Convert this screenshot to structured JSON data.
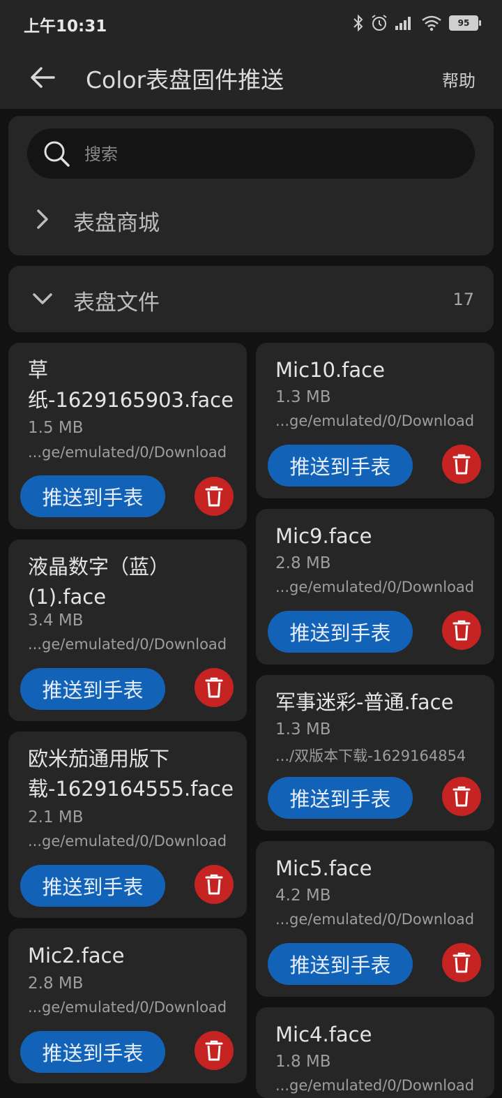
{
  "status_bar": {
    "time": "上午10:31",
    "battery": "95",
    "icons": [
      "bluetooth-icon",
      "alarm-icon",
      "signal-icon",
      "wifi-icon",
      "battery-icon"
    ]
  },
  "app_bar": {
    "title": "Color表盘固件推送",
    "help": "帮助",
    "back_icon": "arrow-back-icon"
  },
  "search": {
    "placeholder": "搜索"
  },
  "store": {
    "label": "表盘商城",
    "expanded": false
  },
  "files": {
    "label": "表盘文件",
    "count": "17",
    "expanded": true
  },
  "cards_left": [
    {
      "name": "草纸-1629165903.face",
      "size": "1.5 MB",
      "path": "...ge/emulated/0/Download",
      "push": "推送到手表"
    },
    {
      "name": "液晶数字（蓝）(1).face",
      "size": "3.4 MB",
      "path": "...ge/emulated/0/Download",
      "push": "推送到手表"
    },
    {
      "name": "欧米茄通用版下载-1629164555.face",
      "size": "2.1 MB",
      "path": "...ge/emulated/0/Download",
      "push": "推送到手表"
    },
    {
      "name": "Mic2.face",
      "size": "2.8 MB",
      "path": "...ge/emulated/0/Download",
      "push": "推送到手表"
    }
  ],
  "cards_right": [
    {
      "name": "Mic10.face",
      "size": "1.3 MB",
      "path": "...ge/emulated/0/Download",
      "push": "推送到手表"
    },
    {
      "name": "Mic9.face",
      "size": "2.8 MB",
      "path": "...ge/emulated/0/Download",
      "push": "推送到手表"
    },
    {
      "name": "军事迷彩-普通.face",
      "size": "1.3 MB",
      "path": ".../双版本下载-1629164854",
      "push": "推送到手表"
    },
    {
      "name": "Mic5.face",
      "size": "4.2 MB",
      "path": "...ge/emulated/0/Download",
      "push": "推送到手表"
    },
    {
      "name": "Mic4.face",
      "size": "1.8 MB",
      "path": "...ge/emulated/0/Download",
      "push": "推送到手表"
    }
  ],
  "colors": {
    "background": "#121212",
    "surface": "#262626",
    "push_button": "#1263b7",
    "delete_button": "#c62323"
  }
}
